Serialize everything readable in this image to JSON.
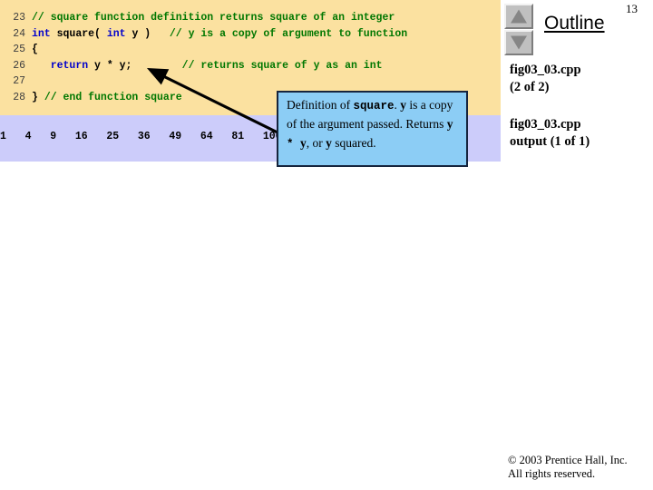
{
  "slide": {
    "page_number": "13",
    "colors": {
      "code_background": "#fbe1a0",
      "output_background": "#ccccfa",
      "callout_background": "#8ccdf5",
      "callout_border": "#16243d",
      "keyword": "#0000cc",
      "comment": "#007700",
      "line_number": "#404040"
    }
  },
  "code": {
    "lines": [
      {
        "number": "23",
        "segments": [
          {
            "kind": "comment",
            "text": "// square function definition returns square of an integer"
          }
        ]
      },
      {
        "number": "24",
        "segments": [
          {
            "kind": "keyword",
            "text": "int"
          },
          {
            "kind": "plain",
            "text": " square( "
          },
          {
            "kind": "keyword",
            "text": "int"
          },
          {
            "kind": "plain",
            "text": " y )   "
          },
          {
            "kind": "comment",
            "text": "// y is a copy of argument to function"
          }
        ]
      },
      {
        "number": "25",
        "segments": [
          {
            "kind": "plain",
            "text": "{"
          }
        ]
      },
      {
        "number": "26",
        "segments": [
          {
            "kind": "plain",
            "text": "   "
          },
          {
            "kind": "keyword",
            "text": "return"
          },
          {
            "kind": "plain",
            "text": " y * y;        "
          },
          {
            "kind": "comment",
            "text": "// returns square of y as an int"
          }
        ]
      },
      {
        "number": "27",
        "segments": [
          {
            "kind": "plain",
            "text": ""
          }
        ]
      },
      {
        "number": "28",
        "segments": [
          {
            "kind": "plain",
            "text": "} "
          },
          {
            "kind": "comment",
            "text": "// end function square"
          }
        ]
      }
    ]
  },
  "output": {
    "text": "1   4   9   16   25   36   49   64   81   100"
  },
  "callout": {
    "parts": [
      {
        "kind": "text",
        "text": "Definition of "
      },
      {
        "kind": "code",
        "text": "square"
      },
      {
        "kind": "text",
        "text": ". "
      },
      {
        "kind": "serif_bold",
        "text": "y"
      },
      {
        "kind": "text",
        "text": " is a copy of the argument passed. Returns "
      },
      {
        "kind": "serif_bold",
        "text": "y"
      },
      {
        "kind": "code",
        "text": " * "
      },
      {
        "kind": "serif_bold",
        "text": "y"
      },
      {
        "kind": "text",
        "text": ", or "
      },
      {
        "kind": "serif_bold",
        "text": "y"
      },
      {
        "kind": "text",
        "text": " squared."
      }
    ],
    "plain_text": "Definition of square. y is a copy of the argument passed. Returns y * y, or y squared."
  },
  "outline": {
    "title": "Outline",
    "nav_up_label": "scroll-up",
    "nav_down_label": "scroll-down",
    "items": [
      {
        "title": "fig03_03.cpp",
        "subtitle": "(2 of 2)"
      },
      {
        "title": "fig03_03.cpp",
        "subtitle": "output (1 of 1)"
      }
    ]
  },
  "footer": {
    "line1": "© 2003 Prentice Hall, Inc.",
    "line2": "All rights reserved."
  }
}
